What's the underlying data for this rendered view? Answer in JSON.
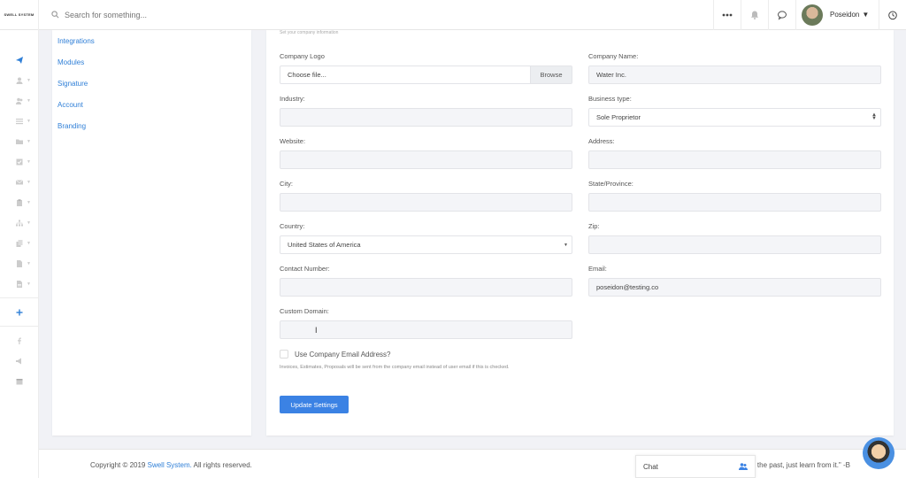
{
  "topbar": {
    "logo_text": "SWELL SYSTEM",
    "search_placeholder": "Search for something...",
    "user_name": "Poseidon"
  },
  "sidebar": {
    "icons": [
      "paper-plane-icon",
      "user-icon",
      "users-icon",
      "list-icon",
      "folder-icon",
      "check-icon",
      "mail-icon",
      "clipboard-icon",
      "sitemap-icon",
      "copy-icon",
      "file-icon",
      "document-icon",
      "plus-icon",
      "facebook-icon",
      "megaphone-icon",
      "calendar-icon"
    ]
  },
  "subnav": {
    "items": [
      "Integrations",
      "Modules",
      "Signature",
      "Account",
      "Branding"
    ]
  },
  "form": {
    "subtitle": "Set your company information",
    "company_logo_label": "Company Logo",
    "company_logo_value": "Choose file...",
    "browse_label": "Browse",
    "company_name_label": "Company Name:",
    "company_name_value": "Water Inc.",
    "industry_label": "Industry:",
    "industry_value": "",
    "business_type_label": "Business type:",
    "business_type_value": "Sole Proprietor",
    "website_label": "Website:",
    "website_value": "",
    "address_label": "Address:",
    "address_value": "",
    "city_label": "City:",
    "city_value": "",
    "state_label": "State/Province:",
    "state_value": "",
    "country_label": "Country:",
    "country_value": "United States of America",
    "zip_label": "Zip:",
    "zip_value": "",
    "contact_label": "Contact Number:",
    "contact_value": "",
    "email_label": "Email:",
    "email_value": "poseidon@testing.co",
    "domain_label": "Custom Domain:",
    "domain_value": "",
    "checkbox_label": "Use Company Email Address?",
    "note": "Invoices, Estimates, Proposals will be sent from the company email instead of user email if this is checked.",
    "update_button": "Update Settings"
  },
  "footer": {
    "copyright_prefix": "Copyright © 2019",
    "brand": "Swell System.",
    "copyright_suffix": "All rights reserved.",
    "quote": "et the past, just learn from it.\" -B"
  },
  "chat": {
    "label": "Chat"
  },
  "colors": {
    "primary": "#3b82e4",
    "link": "#2f7fd7"
  }
}
